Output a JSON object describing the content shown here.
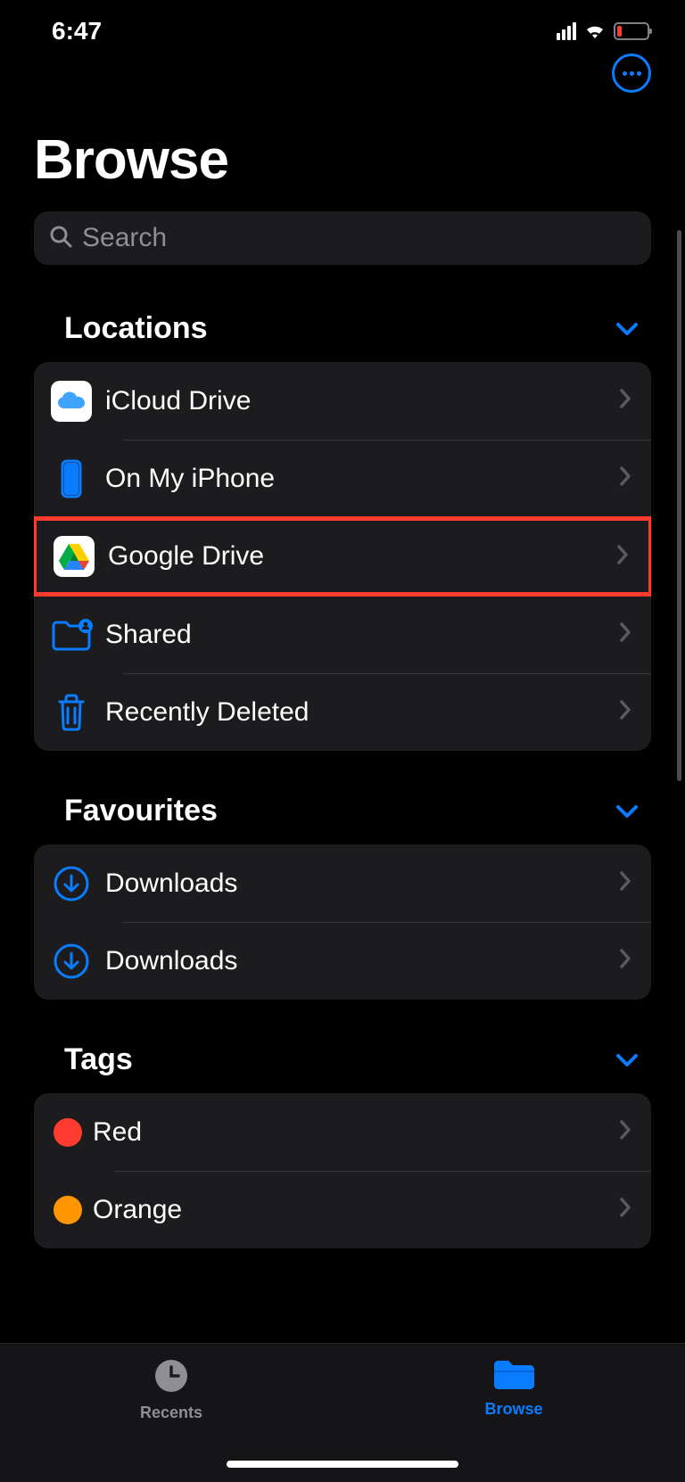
{
  "status": {
    "time": "6:47"
  },
  "header": {
    "title": "Browse"
  },
  "search": {
    "placeholder": "Search"
  },
  "sections": {
    "locations": {
      "title": "Locations",
      "items": [
        {
          "label": "iCloud Drive",
          "icon": "icloud"
        },
        {
          "label": "On My iPhone",
          "icon": "iphone"
        },
        {
          "label": "Google Drive",
          "icon": "gdrive",
          "highlighted": true
        },
        {
          "label": "Shared",
          "icon": "shared"
        },
        {
          "label": "Recently Deleted",
          "icon": "trash"
        }
      ]
    },
    "favourites": {
      "title": "Favourites",
      "items": [
        {
          "label": "Downloads",
          "icon": "download"
        },
        {
          "label": "Downloads",
          "icon": "download"
        }
      ]
    },
    "tags": {
      "title": "Tags",
      "items": [
        {
          "label": "Red",
          "color": "#ff3b30"
        },
        {
          "label": "Orange",
          "color": "#ff9500"
        }
      ]
    }
  },
  "tabbar": {
    "recents": "Recents",
    "browse": "Browse"
  }
}
